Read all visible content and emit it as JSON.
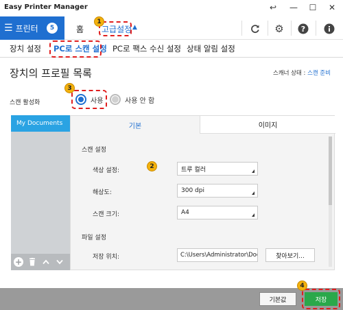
{
  "window": {
    "title": "Easy Printer Manager",
    "controls": {
      "back": "↩",
      "minimize": "—",
      "maximize": "☐",
      "close": "✕"
    }
  },
  "toolbar": {
    "printer_label": "프린터",
    "printer_count": "5",
    "home_label": "홈",
    "advanced_label": "고급설정",
    "icons": [
      "refresh-icon",
      "gear-icon",
      "help-icon",
      "info-icon"
    ]
  },
  "subtabs": [
    {
      "label": "장치 설정"
    },
    {
      "label": "PC로 스캔 설정"
    },
    {
      "label": "PC로 팩스 수신 설정"
    },
    {
      "label": "상태 알림 설정"
    }
  ],
  "main": {
    "title": "장치의 프로필 목록",
    "scanner_status_label": "스캐너 상태 : ",
    "scanner_status_value": "스캔 준비",
    "scan_enable_label": "스캔 활성화",
    "radio_on": "사용",
    "radio_off": "사용 안 함"
  },
  "profiles": {
    "items": [
      "My Documents"
    ],
    "tools": {
      "add": "+",
      "delete": "🗑",
      "up": "⌃",
      "down": "⌄"
    }
  },
  "settings": {
    "tabs": [
      "기본",
      "이미지"
    ],
    "scan_section": "스캔 설정",
    "color_label": "색상 설정:",
    "color_value": "트루 컬러",
    "resolution_label": "해상도:",
    "resolution_value": "300 dpi",
    "size_label": "스캔 크기:",
    "size_value": "A4",
    "file_section": "파일 설정",
    "location_label": "저장 위치:",
    "location_value": "C:\\Users\\Administrator\\Documents",
    "browse_label": "찾아보기..."
  },
  "footer": {
    "default_label": "기본값",
    "save_label": "저장"
  },
  "annotations": [
    "1",
    "2",
    "3",
    "4"
  ],
  "colors": {
    "accent": "#1f6fd0",
    "profile_selected": "#2aa3e3",
    "save": "#2aa84a",
    "annotation_border": "#e01d1d",
    "annotation_badge": "#f3b10d"
  }
}
